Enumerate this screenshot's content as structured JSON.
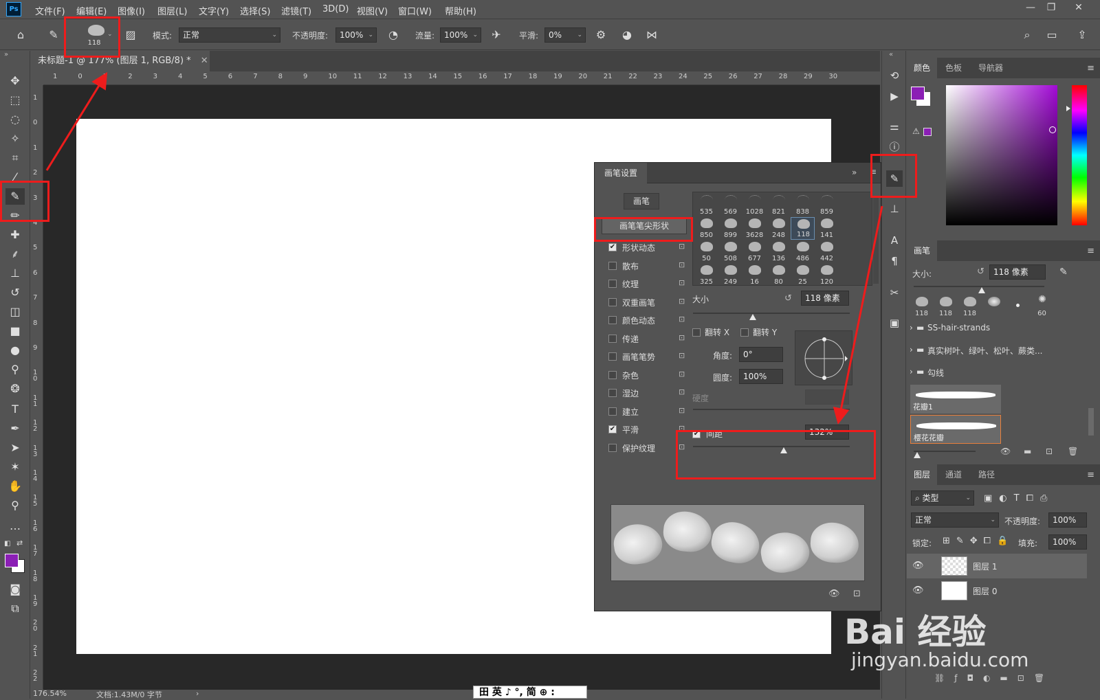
{
  "menubar": {
    "logo": "Ps",
    "items": [
      "文件(F)",
      "编辑(E)",
      "图像(I)",
      "图层(L)",
      "文字(Y)",
      "选择(S)",
      "滤镜(T)",
      "3D(D)",
      "视图(V)",
      "窗口(W)",
      "帮助(H)"
    ],
    "window_controls": [
      "—",
      "❐",
      "✕"
    ]
  },
  "options": {
    "brush_size": "118",
    "mode_label": "模式:",
    "mode_value": "正常",
    "opacity_label": "不透明度:",
    "opacity_value": "100%",
    "flow_label": "流量:",
    "flow_value": "100%",
    "smooth_label": "平滑:",
    "smooth_value": "0%"
  },
  "document": {
    "tab_title": "未标题-1 @ 177% (图层 1, RGB/8) *",
    "zoom": "176.54%",
    "doc_info": "文档:1.43M/0 字节",
    "ruler_h": [
      "1",
      "0",
      "1",
      "2",
      "3",
      "4",
      "5",
      "6",
      "7",
      "8",
      "9",
      "10",
      "11",
      "12",
      "13",
      "14",
      "15",
      "16",
      "17",
      "18",
      "19",
      "20",
      "21",
      "22",
      "23",
      "24",
      "25",
      "26",
      "27",
      "28",
      "29",
      "30"
    ],
    "ruler_v": [
      "1",
      "0",
      "1",
      "2",
      "3",
      "4",
      "5",
      "6",
      "7",
      "8",
      "9",
      "1 0",
      "1 1",
      "1 2",
      "1 3",
      "1 4",
      "1 5",
      "1 6",
      "1 7",
      "1 8",
      "1 9",
      "2 0",
      "2 1",
      "2 2"
    ]
  },
  "ime_bar": "田 英 ♪ °, 简 ⊕ :",
  "brush_settings": {
    "title": "画笔设置",
    "brushes_button": "画笔",
    "tip_shape_button": "画笔笔尖形状",
    "options": [
      {
        "label": "形状动态",
        "checked": true
      },
      {
        "label": "散布",
        "checked": false
      },
      {
        "label": "纹理",
        "checked": false
      },
      {
        "label": "双重画笔",
        "checked": false
      },
      {
        "label": "颜色动态",
        "checked": false
      },
      {
        "label": "传递",
        "checked": false
      },
      {
        "label": "画笔笔势",
        "checked": false
      },
      {
        "label": "杂色",
        "checked": false
      },
      {
        "label": "湿边",
        "checked": false
      },
      {
        "label": "建立",
        "checked": false
      },
      {
        "label": "平滑",
        "checked": true
      },
      {
        "label": "保护纹理",
        "checked": false
      }
    ],
    "tips": [
      "535",
      "569",
      "1028",
      "821",
      "838",
      "859",
      "850",
      "899",
      "3628",
      "248",
      "118",
      "141",
      "50",
      "508",
      "677",
      "136",
      "486",
      "442",
      "325",
      "249",
      "16",
      "80",
      "25",
      "120"
    ],
    "size_label": "大小",
    "size_value": "118 像素",
    "flip_x": "翻转 X",
    "flip_y": "翻转 Y",
    "angle_label": "角度:",
    "angle_value": "0°",
    "roundness_label": "圆度:",
    "roundness_value": "100%",
    "hardness_label": "硬度",
    "spacing_label": "间距",
    "spacing_value": "132%",
    "spacing_checked": true,
    "size_slider": 0.38,
    "spacing_slider": 0.58
  },
  "color_panel": {
    "tabs": [
      "颜色",
      "色板",
      "导航器"
    ],
    "foreground": "#8b1fb5",
    "background": "#ffffff",
    "warning": "⚠"
  },
  "brush_panel": {
    "title": "画笔",
    "size_label": "大小:",
    "size_value": "118 像素",
    "presets": [
      "118",
      "118",
      "118",
      "",
      "",
      "60"
    ],
    "groups": [
      "SS-hair-strands",
      "真实树叶、绿叶、松叶、蕨类...",
      "勾线"
    ],
    "strokes": [
      "花瓣1",
      "樱花花瓣"
    ]
  },
  "layers_panel": {
    "tabs": [
      "图层",
      "通道",
      "路径"
    ],
    "filter": "类型",
    "blend": "正常",
    "opacity_label": "不透明度:",
    "opacity_value": "100%",
    "lock_label": "锁定:",
    "fill_label": "填充:",
    "fill_value": "100%",
    "layers": [
      "图层 1",
      "图层 0"
    ]
  },
  "watermark": {
    "main": "Bai 经验",
    "sub": "jingyan.baidu.com"
  }
}
